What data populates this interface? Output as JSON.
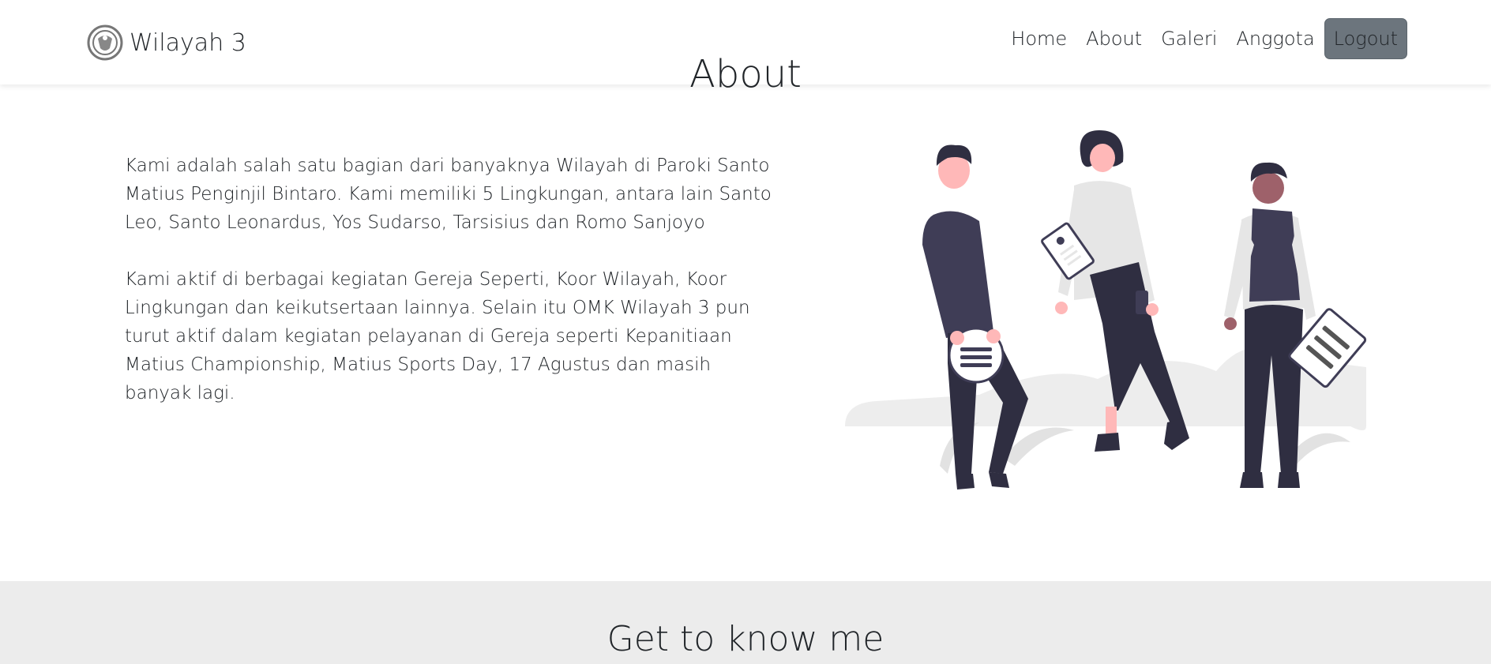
{
  "navbar": {
    "brand": "Wilayah 3",
    "links": [
      "Home",
      "About",
      "Galeri",
      "Anggota"
    ],
    "logout_label": "Logout"
  },
  "about": {
    "title": "About",
    "paragraphs": [
      "Kami adalah salah satu bagian dari banyaknya Wilayah di Paroki Santo Matius Penginjil Bintaro. Kami memiliki 5 Lingkungan, antara lain Santo Leo, Santo Leonardus, Yos Sudarso, Tarsisius dan Romo Sanjoyo",
      "Kami aktif di berbagai kegiatan Gereja Seperti, Koor Wilayah, Koor Lingkungan dan keikutsertaan lainnya. Selain itu OMK Wilayah 3 pun turut aktif dalam kegiatan pelayanan di Gereja seperti Kepanitiaan Matius Championship, Matius Sports Day, 17 Agustus dan masih banyak lagi."
    ]
  },
  "section2": {
    "title": "Get to know me"
  },
  "colors": {
    "logout_bg": "#6c757d",
    "footer_bg": "#ececec",
    "accent_dark": "#3f3d56",
    "skin": "#ffb8b8"
  }
}
